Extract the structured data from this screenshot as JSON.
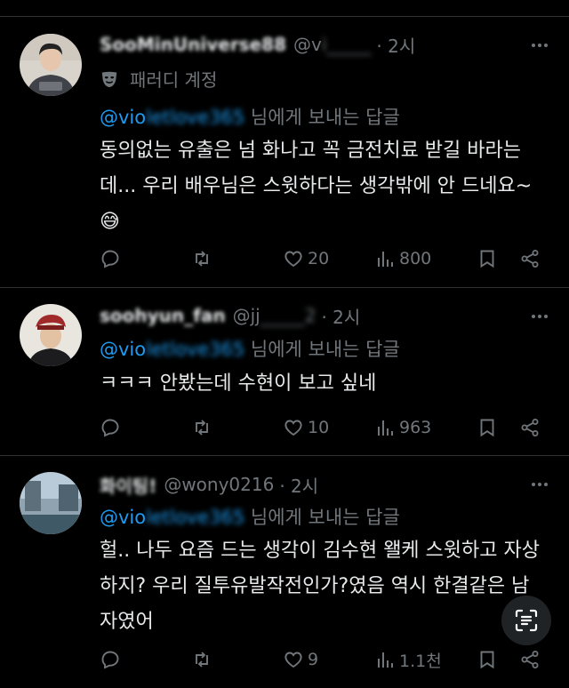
{
  "posts": [
    {
      "display_name": "SooMinUniverse88",
      "handle_prefix": "@v",
      "handle_hidden": "i_____",
      "time": "· 2시",
      "badge": "패러디 계정",
      "reply_prefix": "@vio",
      "reply_hidden": "letlove365",
      "reply_suffix": " 님에게 보내는 답글",
      "text": "동의없는 유출은 넘 화나고 꼭 금전치료 받길 바라는데...  우리 배우님은 스윗하다는 생각밖에 안 드네요~",
      "emoji": "😅",
      "likes": "20",
      "views": "800"
    },
    {
      "display_name": "soohyun_fan",
      "handle_prefix": "@jj",
      "handle_hidden": "_____2",
      "time": "· 2시",
      "reply_prefix": "@vio",
      "reply_hidden": "letlove365",
      "reply_suffix": " 님에게 보내는 답글",
      "text": "ㅋㅋㅋ 안봤는데 수현이 보고 싶네",
      "likes": "10",
      "views": "963"
    },
    {
      "display_name": "화이팅!",
      "handle_prefix": "@wony0216",
      "handle_hidden": "",
      "time": "· 2시",
      "reply_prefix": "@vio",
      "reply_hidden": "letlove365",
      "reply_suffix": " 님에게 보내는 답글",
      "text": "헐.. 나두 요즘 드는 생각이 김수현 왤케 스윗하고 자상하지? 우리 질투유발작전인가?였음 역시 한결같은 남자였어",
      "likes": "9",
      "views": "1.1천"
    }
  ],
  "colors": {
    "accent": "#1d9bf0",
    "muted": "#71767b",
    "text": "#e7e9ea",
    "divider": "#2f3336"
  },
  "icons": [
    "reply-icon",
    "retweet-icon",
    "heart-icon",
    "views-icon",
    "bookmark-icon",
    "share-icon",
    "more-icon",
    "parody-mask-icon",
    "text-recognition-icon"
  ]
}
